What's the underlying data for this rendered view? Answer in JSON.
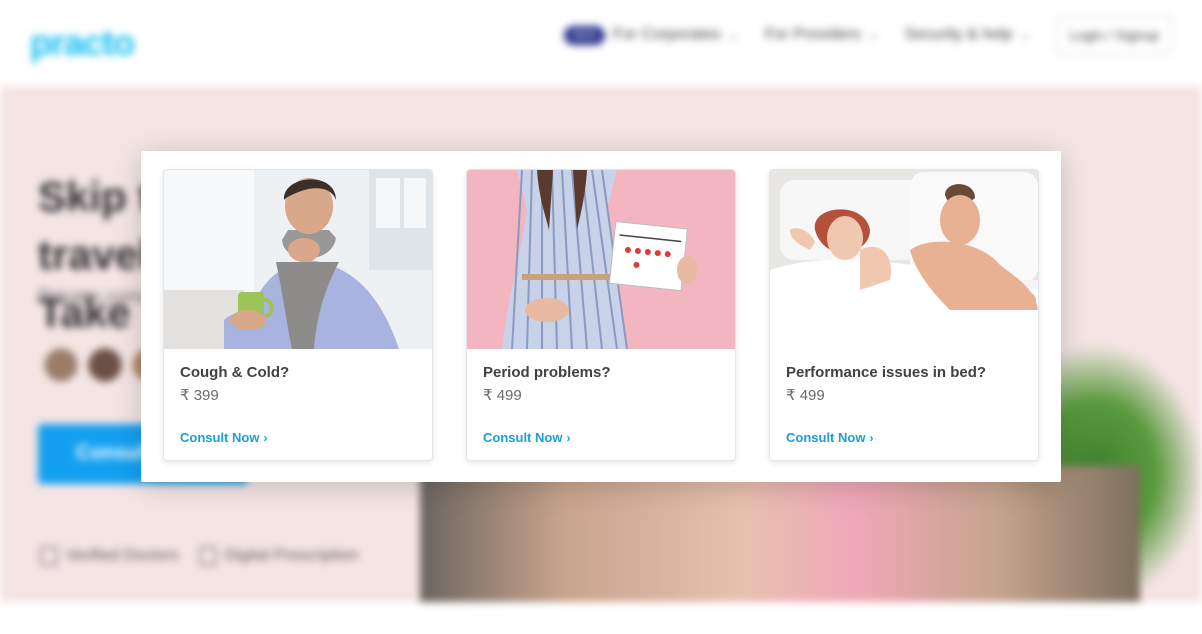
{
  "navbar": {
    "logo": "practo",
    "new_badge": "NEW",
    "items": [
      {
        "label": "For Corporates"
      },
      {
        "label": "For Providers"
      },
      {
        "label": "Security & help"
      }
    ],
    "login_label": "Login / Signup"
  },
  "hero": {
    "title": "Skip the travel! Take",
    "subtitle": "Private consultation",
    "cta_label": "Consult",
    "features": [
      "Verified Doctors",
      "Digital Prescription"
    ]
  },
  "modal": {
    "cards": [
      {
        "title": "Cough & Cold?",
        "currency": "₹",
        "price": "399",
        "link_label": "Consult Now",
        "image_icon": "man-with-cold-photo"
      },
      {
        "title": "Period problems?",
        "currency": "₹",
        "price": "499",
        "link_label": "Consult Now",
        "image_icon": "woman-with-calendar-photo"
      },
      {
        "title": "Performance issues in bed?",
        "currency": "₹",
        "price": "499",
        "link_label": "Consult Now",
        "image_icon": "couple-in-bed-photo"
      }
    ]
  },
  "colors": {
    "accent": "#199fd9",
    "brand": "#14bef0",
    "brand_dark": "#28328c",
    "hero_bg": "#f4e4e4"
  }
}
